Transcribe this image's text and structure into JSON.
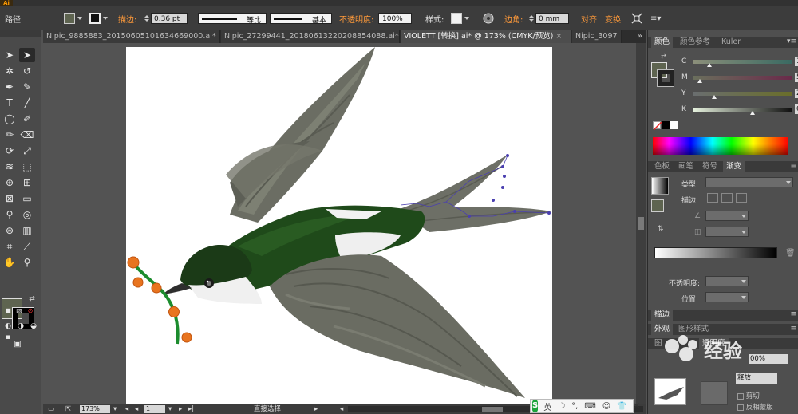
{
  "controlbar": {
    "object_type": "路径",
    "stroke_label": "描边:",
    "stroke_weight": "0.36 pt",
    "profile_label": "等比",
    "brush_label": "基本",
    "opacity_label": "不透明度:",
    "opacity_value": "100%",
    "style_label": "样式:",
    "corner_label": "边角:",
    "corner_value": "0 mm",
    "align_label": "对齐",
    "transform_label": "变换"
  },
  "tabs": [
    {
      "label": "Nipic_9885883_20150605101634669000.ai*",
      "active": false
    },
    {
      "label": "Nipic_27299441_20180613220208854088.ai*",
      "active": false
    },
    {
      "label": "VIOLETT [转换].ai* @ 173% (CMYK/预览)",
      "active": true
    },
    {
      "label": "Nipic_3097",
      "active": false
    }
  ],
  "tabs_more": "»",
  "color_panel": {
    "tabs": [
      "颜色",
      "颜色参考",
      "Kuler"
    ],
    "sliders": [
      {
        "label": "C",
        "value": "15",
        "pct": "%",
        "level": 0.15
      },
      {
        "label": "M",
        "value": "5",
        "pct": "%",
        "level": 0.05
      },
      {
        "label": "Y",
        "value": "20",
        "pct": "%",
        "level": 0.2
      },
      {
        "label": "K",
        "value": "60",
        "pct": "%",
        "level": 0.6
      }
    ]
  },
  "gradient_panel": {
    "tabs": [
      "色板",
      "画笔",
      "符号",
      "渐变"
    ],
    "type_label": "类型:",
    "stroke_label": "描边:",
    "opacity_label": "不透明度:",
    "position_label": "位置:"
  },
  "stroke_panel": {
    "title": "描边"
  },
  "appearance_panel": {
    "tabs": [
      "外观",
      "图形样式"
    ],
    "transparency_tabs": [
      "图",
      "透明度"
    ],
    "opacity_value": "00%",
    "clip_label": "剪切",
    "invert_label": "反相蒙版",
    "release_label": "释放"
  },
  "statusbar": {
    "zoom": "173%",
    "page": "1",
    "tool": "直接选择"
  },
  "ime": {
    "logo": "S",
    "mode": "英"
  },
  "watermark": {
    "text": "经验"
  },
  "colors": {
    "fill": "#5e6450",
    "accent_orange": "#ff9a3a",
    "bird_green": "#1f4a1a",
    "wing_gray": "#6a6c62"
  }
}
